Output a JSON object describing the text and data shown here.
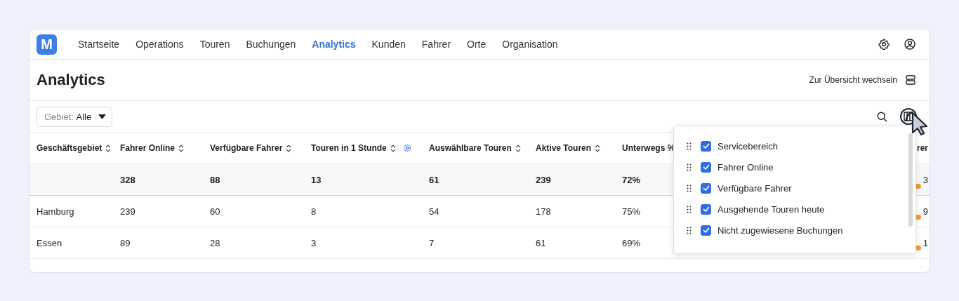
{
  "logo": {
    "text": "M"
  },
  "nav": [
    {
      "label": "Startseite",
      "selected": false
    },
    {
      "label": "Operations",
      "selected": false
    },
    {
      "label": "Touren",
      "selected": false
    },
    {
      "label": "Buchungen",
      "selected": false
    },
    {
      "label": "Analytics",
      "selected": true
    },
    {
      "label": "Kunden",
      "selected": false
    },
    {
      "label": "Fahrer",
      "selected": false
    },
    {
      "label": "Orte",
      "selected": false
    },
    {
      "label": "Organisation",
      "selected": false
    }
  ],
  "page": {
    "title": "Analytics",
    "view_switch": "Zur Übersicht wechseln"
  },
  "filter": {
    "label": "Gebiet:",
    "value": "Alle"
  },
  "table": {
    "columns": [
      {
        "label": "Geschäftsgebiet",
        "sortable": true,
        "settings": false
      },
      {
        "label": "Fahrer Online",
        "sortable": true,
        "settings": false
      },
      {
        "label": "Verfügbare Fahrer",
        "sortable": true,
        "settings": false
      },
      {
        "label": "Touren in 1 Stunde",
        "sortable": true,
        "settings": true
      },
      {
        "label": "Auswählbare Touren",
        "sortable": true,
        "settings": false
      },
      {
        "label": "Aktive Touren",
        "sortable": true,
        "settings": false
      },
      {
        "label": "Unterwegs %"
      },
      {
        "label": "rer"
      }
    ],
    "total_row": [
      "328",
      "88",
      "13",
      "61",
      "239",
      "72%",
      "3"
    ],
    "rows": [
      [
        "Hamburg",
        "239",
        "60",
        "8",
        "54",
        "178",
        "75%",
        "9"
      ],
      [
        "Essen",
        "89",
        "28",
        "3",
        "7",
        "61",
        "69%",
        "1"
      ]
    ]
  },
  "column_menu": {
    "items": [
      {
        "label": "Servicebereich",
        "checked": true
      },
      {
        "label": "Fahrer Online",
        "checked": true
      },
      {
        "label": "Verfügbare Fahrer",
        "checked": true
      },
      {
        "label": "Ausgehende Touren heute",
        "checked": true
      },
      {
        "label": "Nicht zugewiesene Buchungen",
        "checked": true
      }
    ]
  }
}
